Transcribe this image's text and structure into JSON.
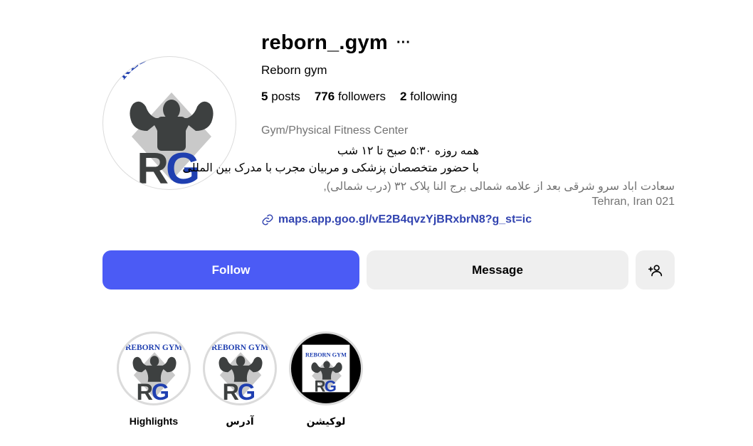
{
  "profile": {
    "username": "reborn_.gym",
    "full_name": "Reborn gym",
    "category": "Gym/Physical Fitness Center",
    "bio_line_1": "همه روزه ۵:۳۰ صبح تا ۱۲ شب",
    "bio_line_2": "با حضور متخصصان پزشکی و مربیان مجرب با مدرک بین المللی",
    "address_line_1": "سعادت اباد سرو شرقی بعد از علامه شمالی برج النا پلاک ۳۲ (درب شمالی),",
    "address_line_2": "Tehran, Iran 021",
    "link": "maps.app.goo.gl/vE2B4qvzYjBRxbrN8?g_st=ic",
    "logo_text_arc": "REBORN GYM",
    "logo_letters": "RG"
  },
  "stats": {
    "posts_count": "5",
    "posts_label": "posts",
    "followers_count": "776",
    "followers_label": "followers",
    "following_count": "2",
    "following_label": "following"
  },
  "actions": {
    "follow_label": "Follow",
    "message_label": "Message",
    "more_label": "···"
  },
  "highlights": [
    {
      "label": "Highlights"
    },
    {
      "label": "آدرس"
    },
    {
      "label": "لوکیشن"
    }
  ],
  "colors": {
    "follow_bg": "#4b5bf5",
    "link": "#3143b0",
    "logo_blue": "#1f3fb0",
    "logo_dark": "#3d4040"
  }
}
